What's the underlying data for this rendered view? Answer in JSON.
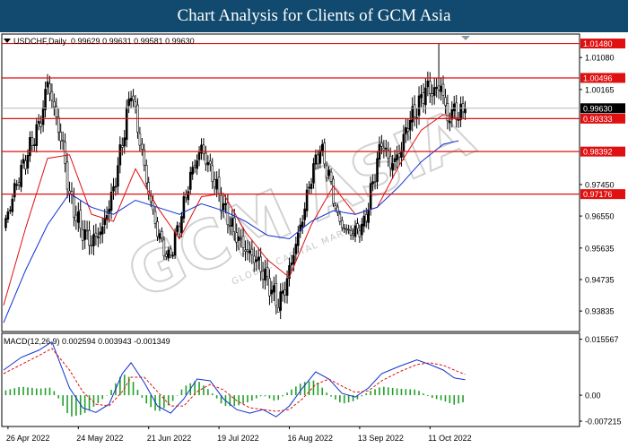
{
  "header": {
    "title": "Chart Analysis for Clients of GCM Asia"
  },
  "symbol_line": {
    "symbol": "USDCHF,Daily",
    "ohlc": "0.99629 0.99631 0.99581 0.99630"
  },
  "macd_line": {
    "label": "MACD(12,26,9)",
    "values": "0.002594 0.003943 -0.001349"
  },
  "watermark": {
    "text": "GCM ASIA",
    "subtext": "GLOBAL CAPITAL MARKETS"
  },
  "colors": {
    "header_bg": "#114a6e",
    "resistance": "#e01010",
    "ma_fast": "#e01010",
    "ma_slow": "#1030d0",
    "macd_line": "#1030d0",
    "signal_line": "#e01010",
    "histogram": "#22a02a",
    "candle": "#000000"
  },
  "chart_data": [
    {
      "type": "candlestick",
      "title": "",
      "y_ticks": [
        "1.01080",
        "1.00165",
        "0.97450",
        "0.96550",
        "0.95635",
        "0.94735",
        "0.93835"
      ],
      "ylim": [
        0.9325,
        1.0175
      ],
      "x_ticks": [
        "26 Apr 2022",
        "24 May 2022",
        "21 Jun 2022",
        "19 Jul 2022",
        "16 Aug 2022",
        "13 Sep 2022",
        "11 Oct 2022"
      ],
      "current_price": "0.99630",
      "levels": [
        {
          "label": "1.01480",
          "value": 1.0148
        },
        {
          "label": "1.00496",
          "value": 1.00496
        },
        {
          "label": "0.99333",
          "value": 0.99333
        },
        {
          "label": "0.98392",
          "value": 0.98392
        },
        {
          "label": "0.97176",
          "value": 0.97176
        }
      ],
      "close_path": [
        [
          0,
          0.962
        ],
        [
          6,
          0.975
        ],
        [
          12,
          0.985
        ],
        [
          17,
          0.993
        ],
        [
          20,
          1.004
        ],
        [
          23,
          0.996
        ],
        [
          27,
          0.985
        ],
        [
          30,
          0.971
        ],
        [
          35,
          0.962
        ],
        [
          40,
          0.958
        ],
        [
          45,
          0.962
        ],
        [
          50,
          0.973
        ],
        [
          55,
          0.99
        ],
        [
          58,
          1.002
        ],
        [
          62,
          0.987
        ],
        [
          66,
          0.972
        ],
        [
          70,
          0.961
        ],
        [
          75,
          0.953
        ],
        [
          80,
          0.963
        ],
        [
          85,
          0.977
        ],
        [
          90,
          0.985
        ],
        [
          95,
          0.977
        ],
        [
          100,
          0.968
        ],
        [
          105,
          0.961
        ],
        [
          110,
          0.956
        ],
        [
          115,
          0.953
        ],
        [
          120,
          0.947
        ],
        [
          125,
          0.94
        ],
        [
          128,
          0.945
        ],
        [
          132,
          0.955
        ],
        [
          136,
          0.965
        ],
        [
          140,
          0.977
        ],
        [
          144,
          0.985
        ],
        [
          148,
          0.977
        ],
        [
          152,
          0.965
        ],
        [
          156,
          0.961
        ],
        [
          160,
          0.961
        ],
        [
          164,
          0.963
        ],
        [
          168,
          0.975
        ],
        [
          172,
          0.987
        ],
        [
          176,
          0.98
        ],
        [
          180,
          0.983
        ],
        [
          184,
          0.992
        ],
        [
          188,
          0.996
        ],
        [
          192,
          1.002
        ],
        [
          196,
          1.001
        ],
        [
          199,
          1.003
        ],
        [
          202,
          0.993
        ],
        [
          205,
          0.996
        ],
        [
          207,
          0.994
        ],
        [
          210,
          0.9963
        ]
      ],
      "ma_fast": [
        [
          0,
          0.94
        ],
        [
          10,
          0.962
        ],
        [
          20,
          0.982
        ],
        [
          30,
          0.983
        ],
        [
          40,
          0.966
        ],
        [
          50,
          0.964
        ],
        [
          60,
          0.979
        ],
        [
          70,
          0.968
        ],
        [
          80,
          0.959
        ],
        [
          90,
          0.971
        ],
        [
          100,
          0.972
        ],
        [
          110,
          0.961
        ],
        [
          120,
          0.953
        ],
        [
          130,
          0.948
        ],
        [
          140,
          0.963
        ],
        [
          150,
          0.974
        ],
        [
          160,
          0.966
        ],
        [
          170,
          0.968
        ],
        [
          180,
          0.98
        ],
        [
          190,
          0.99
        ],
        [
          200,
          0.9945
        ],
        [
          207,
          0.9935
        ]
      ],
      "ma_slow": [
        [
          0,
          0.935
        ],
        [
          10,
          0.95
        ],
        [
          20,
          0.963
        ],
        [
          30,
          0.972
        ],
        [
          40,
          0.968
        ],
        [
          50,
          0.966
        ],
        [
          60,
          0.97
        ],
        [
          70,
          0.968
        ],
        [
          80,
          0.966
        ],
        [
          90,
          0.969
        ],
        [
          100,
          0.967
        ],
        [
          110,
          0.964
        ],
        [
          120,
          0.96
        ],
        [
          130,
          0.959
        ],
        [
          140,
          0.964
        ],
        [
          150,
          0.967
        ],
        [
          160,
          0.966
        ],
        [
          170,
          0.968
        ],
        [
          180,
          0.974
        ],
        [
          190,
          0.981
        ],
        [
          200,
          0.986
        ],
        [
          207,
          0.987
        ]
      ]
    },
    {
      "type": "line",
      "title": "MACD(12,26,9)",
      "y_ticks": [
        "0.015567",
        "0.00",
        "-0.007215"
      ],
      "ylim": [
        -0.0087,
        0.0172
      ],
      "macd": [
        [
          0,
          0.007
        ],
        [
          8,
          0.0105
        ],
        [
          16,
          0.0125
        ],
        [
          22,
          0.0148
        ],
        [
          30,
          0.002
        ],
        [
          36,
          -0.0035
        ],
        [
          42,
          -0.0048
        ],
        [
          48,
          -0.0025
        ],
        [
          54,
          0.006
        ],
        [
          58,
          0.009
        ],
        [
          64,
          0.0035
        ],
        [
          70,
          -0.003
        ],
        [
          76,
          -0.005
        ],
        [
          82,
          -0.001
        ],
        [
          88,
          0.0045
        ],
        [
          94,
          0.004
        ],
        [
          100,
          -0.001
        ],
        [
          106,
          -0.004
        ],
        [
          112,
          -0.005
        ],
        [
          118,
          -0.004
        ],
        [
          124,
          -0.006
        ],
        [
          130,
          -0.003
        ],
        [
          136,
          0.002
        ],
        [
          142,
          0.0065
        ],
        [
          148,
          0.0045
        ],
        [
          154,
          0.0005
        ],
        [
          160,
          -0.0005
        ],
        [
          166,
          0.002
        ],
        [
          172,
          0.006
        ],
        [
          180,
          0.008
        ],
        [
          188,
          0.0098
        ],
        [
          194,
          0.0085
        ],
        [
          200,
          0.007
        ],
        [
          205,
          0.0048
        ],
        [
          210,
          0.0043
        ]
      ],
      "signal": [
        [
          0,
          0.006
        ],
        [
          8,
          0.0085
        ],
        [
          16,
          0.011
        ],
        [
          22,
          0.013
        ],
        [
          30,
          0.007
        ],
        [
          36,
          0.001
        ],
        [
          42,
          -0.0025
        ],
        [
          48,
          -0.003
        ],
        [
          54,
          0.001
        ],
        [
          58,
          0.005
        ],
        [
          64,
          0.005
        ],
        [
          70,
          0.001
        ],
        [
          76,
          -0.003
        ],
        [
          82,
          -0.003
        ],
        [
          88,
          0.001
        ],
        [
          94,
          0.003
        ],
        [
          100,
          0.0015
        ],
        [
          106,
          -0.0015
        ],
        [
          112,
          -0.0035
        ],
        [
          118,
          -0.004
        ],
        [
          124,
          -0.0045
        ],
        [
          130,
          -0.004
        ],
        [
          136,
          -0.001
        ],
        [
          142,
          0.003
        ],
        [
          148,
          0.0045
        ],
        [
          154,
          0.0025
        ],
        [
          160,
          0.0008
        ],
        [
          166,
          0.0012
        ],
        [
          172,
          0.004
        ],
        [
          180,
          0.0065
        ],
        [
          188,
          0.0085
        ],
        [
          194,
          0.009
        ],
        [
          200,
          0.0083
        ],
        [
          205,
          0.007
        ],
        [
          210,
          0.0058
        ]
      ]
    }
  ]
}
